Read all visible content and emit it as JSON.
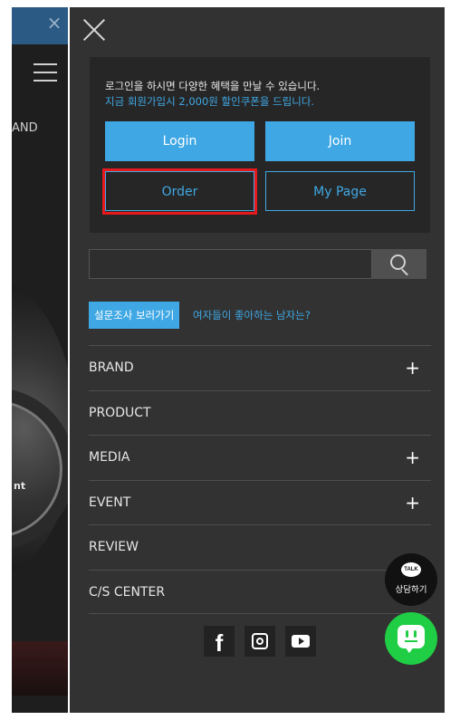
{
  "background": {
    "brand_fragment": "AND",
    "watch_text": "nt"
  },
  "login_box": {
    "message": "로그인을 하시면 다양한 혜택을 만날 수 있습니다.",
    "sub_message": "지금 회원가입시 2,000원 할인쿠폰을 드립니다.",
    "login_label": "Login",
    "join_label": "Join",
    "order_label": "Order",
    "mypage_label": "My Page"
  },
  "search": {
    "value": "",
    "icon": "search-icon"
  },
  "survey": {
    "tag_label": "설문조사 보러가기",
    "link_text": "여자들이 좋아하는 남자는?"
  },
  "nav": {
    "items": [
      {
        "label": "BRAND",
        "expandable": true
      },
      {
        "label": "PRODUCT",
        "expandable": false
      },
      {
        "label": "MEDIA",
        "expandable": true
      },
      {
        "label": "EVENT",
        "expandable": true
      },
      {
        "label": "REVIEW",
        "expandable": false
      },
      {
        "label": "C/S CENTER",
        "expandable": false
      }
    ],
    "plus_symbol": "+"
  },
  "social": {
    "facebook_glyph": "f",
    "icons": [
      "facebook-icon",
      "instagram-icon",
      "youtube-icon"
    ]
  },
  "floating": {
    "talk_badge": "TALK",
    "talk_label": "상담하기"
  },
  "colors": {
    "accent": "#3fa8e4",
    "panel_bg": "#323232",
    "login_box_bg": "#262626",
    "highlight_red": "#e8191c",
    "chat_green": "#1fce45"
  }
}
